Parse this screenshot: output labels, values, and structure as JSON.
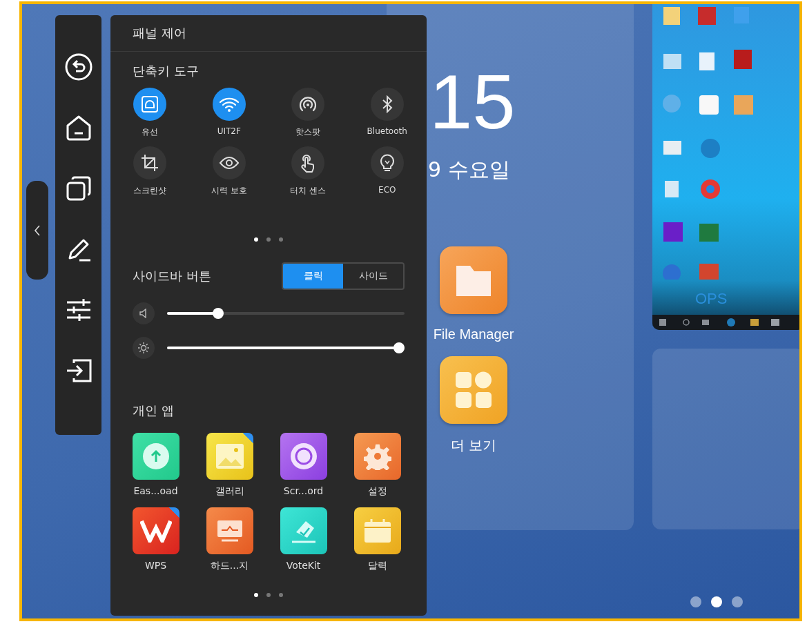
{
  "home": {
    "clock": "15",
    "date": "9 수요일",
    "apps": [
      {
        "label": "File Manager",
        "kind": "files"
      },
      {
        "label": "더 보기",
        "kind": "more"
      }
    ],
    "desktop_preview": {
      "label": "OPS"
    },
    "pages": [
      {
        "selected": false
      },
      {
        "selected": true
      },
      {
        "selected": false
      }
    ]
  },
  "panel": {
    "title": "패널 제어",
    "shortcuts": {
      "title": "단축키 도구",
      "items": [
        {
          "label": "유선",
          "kind": "ethernet",
          "on": true
        },
        {
          "label": "UIT2F",
          "kind": "wifi",
          "on": true
        },
        {
          "label": "핫스팟",
          "kind": "hotspot",
          "on": false
        },
        {
          "label": "Bluetooth",
          "kind": "bluetooth",
          "on": false
        },
        {
          "label": "스크린샷",
          "kind": "screenshot",
          "on": false
        },
        {
          "label": "시력 보호",
          "kind": "eye",
          "on": false
        },
        {
          "label": "터치 센스",
          "kind": "touch",
          "on": false
        },
        {
          "label": "ECO",
          "kind": "eco",
          "on": false
        }
      ],
      "pages": [
        {
          "selected": true
        },
        {
          "selected": false
        },
        {
          "selected": false
        }
      ]
    },
    "sidebar_button": {
      "label": "사이드바 버튼",
      "options": [
        {
          "label": "클릭",
          "selected": true
        },
        {
          "label": "사이드",
          "selected": false
        }
      ]
    },
    "sliders": [
      {
        "kind": "volume",
        "level": 0.2
      },
      {
        "kind": "brightness",
        "level": 1.0
      }
    ],
    "personal_apps": {
      "title": "개인 앱",
      "items": [
        {
          "label": "Eas...oad",
          "kind": "upload",
          "badge": false
        },
        {
          "label": "갤러리",
          "kind": "gallery",
          "badge": true
        },
        {
          "label": "Scr...ord",
          "kind": "record",
          "badge": false
        },
        {
          "label": "설정",
          "kind": "settings",
          "badge": false
        },
        {
          "label": "WPS",
          "kind": "wps",
          "badge": true
        },
        {
          "label": "하드...지",
          "kind": "board",
          "badge": false
        },
        {
          "label": "VoteKit",
          "kind": "vote",
          "badge": false
        },
        {
          "label": "달력",
          "kind": "calendar",
          "badge": false
        }
      ],
      "pages": [
        {
          "selected": true
        },
        {
          "selected": false
        },
        {
          "selected": false
        }
      ]
    }
  }
}
